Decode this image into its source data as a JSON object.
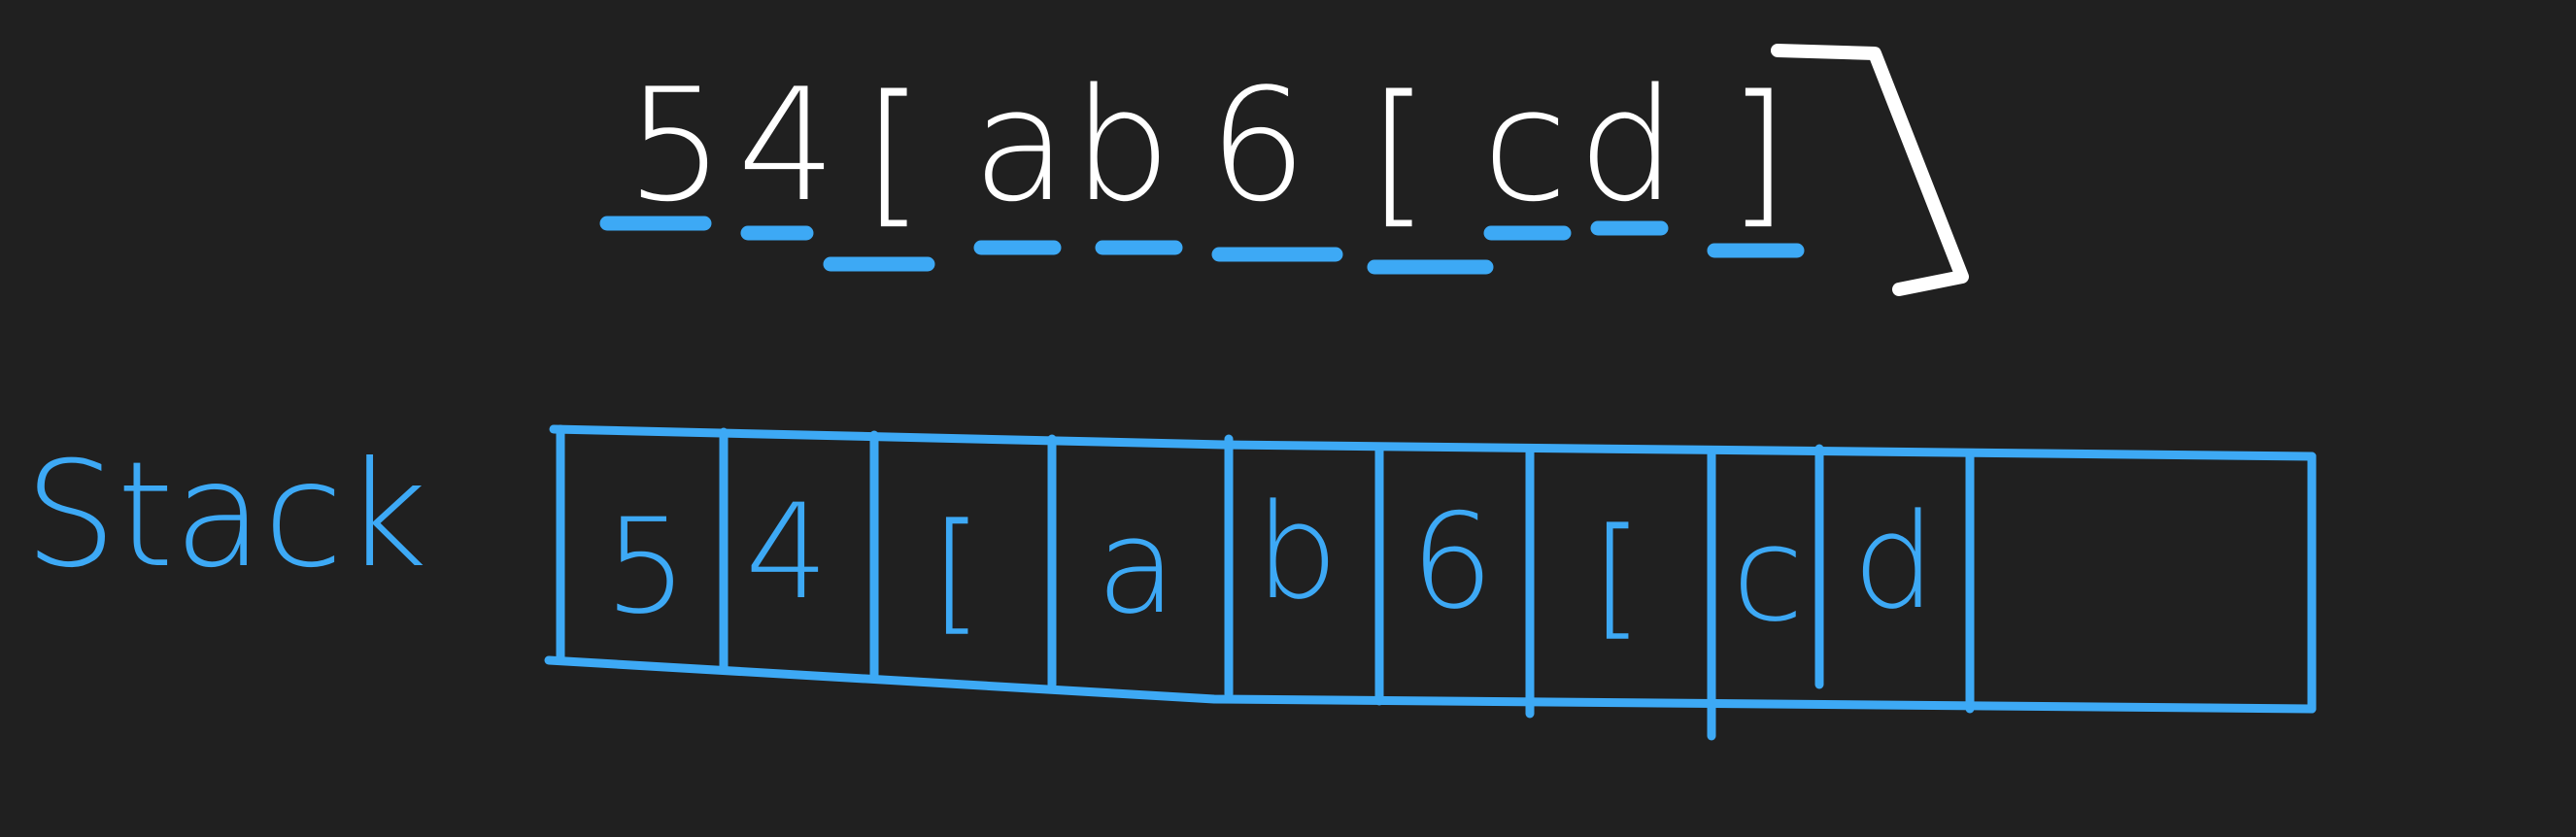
{
  "expression": {
    "tokens": [
      "5",
      "4",
      "[",
      "a",
      "b",
      "6",
      "[",
      "c",
      "d",
      "]"
    ],
    "closing_bracket": "]",
    "ink_color": "#FFFFFF",
    "underline_color": "#3DA9F5"
  },
  "stack": {
    "label": "Stack",
    "cells": [
      "5",
      "4",
      "[",
      "a",
      "b",
      "6",
      "[",
      "c",
      "d",
      ""
    ],
    "ink_color": "#3DA9F5"
  },
  "background_color": "#202020"
}
